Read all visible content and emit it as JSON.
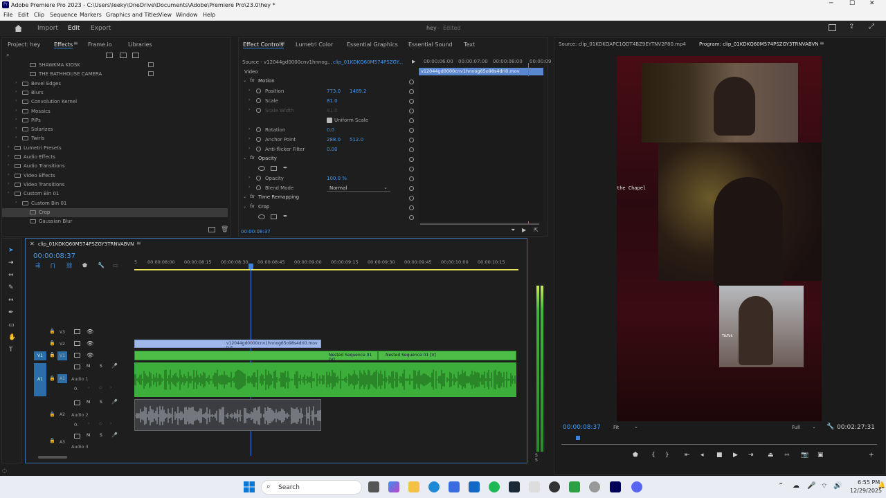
{
  "titlebar": {
    "title": "Adobe Premiere Pro 2023 - C:\\Users\\leeky\\OneDrive\\Documents\\Adobe\\Premiere Pro\\23.0\\hey *"
  },
  "menu": [
    "File",
    "Edit",
    "Clip",
    "Sequence",
    "Markers",
    "Graphics and Titles",
    "View",
    "Window",
    "Help"
  ],
  "workspace": {
    "tabs": [
      "Import",
      "Edit",
      "Export"
    ],
    "active": "Edit",
    "project": "hey",
    "status": "Edited"
  },
  "left_panel": {
    "tabs": [
      "Project: hey",
      "Effects",
      "Frame.io",
      "Libraries"
    ],
    "active": "Effects",
    "items": [
      {
        "label": "SHAWKMA KIOSK",
        "indent": 2
      },
      {
        "label": "THE BATHHOUSE CAMERA",
        "indent": 2
      },
      {
        "label": "Bevel Edges",
        "indent": 1
      },
      {
        "label": "Blurs",
        "indent": 1
      },
      {
        "label": "Convolution Kernel",
        "indent": 1
      },
      {
        "label": "Mosaics",
        "indent": 1
      },
      {
        "label": "PiPs",
        "indent": 1
      },
      {
        "label": "Solarizes",
        "indent": 1
      },
      {
        "label": "Twirls",
        "indent": 1
      },
      {
        "label": "Lumetri Presets",
        "indent": 0
      },
      {
        "label": "Audio Effects",
        "indent": 0
      },
      {
        "label": "Audio Transitions",
        "indent": 0
      },
      {
        "label": "Video Effects",
        "indent": 0
      },
      {
        "label": "Video Transitions",
        "indent": 0
      },
      {
        "label": "Custom Bin 01",
        "indent": 0
      },
      {
        "label": "Custom Bin 01",
        "indent": 1
      },
      {
        "label": "Crop",
        "indent": 2,
        "selected": true
      },
      {
        "label": "Gaussian Blur",
        "indent": 2
      }
    ]
  },
  "effect_controls": {
    "tabs": [
      "Effect Controls",
      "Lumetri Color",
      "Essential Graphics",
      "Essential Sound",
      "Text"
    ],
    "source": "Source - v12044gd0000cnv1hnnog...",
    "clip": "clip_01KDKQ60M574PSZGY...",
    "section": "Video",
    "timecodes": [
      "00:00:06:00",
      "00:00:07:00",
      "00:00:08:00",
      "00:00:09"
    ],
    "clip_bar": "v12044gd0000cnv1hnnog65o98s4dri0.mov",
    "current_time": "00:00:08:37",
    "rows": [
      {
        "label": "Motion",
        "type": "fx"
      },
      {
        "label": "Position",
        "v1": "773.0",
        "v2": "1489.2"
      },
      {
        "label": "Scale",
        "v1": "81.0"
      },
      {
        "label": "Scale Width",
        "v1": "81.0",
        "disabled": true
      },
      {
        "label": "Uniform Scale",
        "type": "check"
      },
      {
        "label": "Rotation",
        "v1": "0.0"
      },
      {
        "label": "Anchor Point",
        "v1": "288.0",
        "v2": "512.0"
      },
      {
        "label": "Anti-flicker Filter",
        "v1": "0.00"
      },
      {
        "label": "Opacity",
        "type": "fx"
      },
      {
        "label": "",
        "type": "masks"
      },
      {
        "label": "Opacity",
        "v1": "100.0 %"
      },
      {
        "label": "Blend Mode",
        "dropdown": "Normal"
      },
      {
        "label": "Time Remapping",
        "type": "fx"
      },
      {
        "label": "Crop",
        "type": "fx"
      },
      {
        "label": "",
        "type": "masks"
      }
    ]
  },
  "monitor": {
    "source_tab": "Source: clip_01KDKQAPC1QDT4BZ9EYTNV2P80.mp4",
    "program_tab": "Program: clip_01KDKQ60M574PSZGY3TRNVABVN",
    "overlay_text": "the Chapel",
    "tiktok": "TikTok",
    "current": "00:00:08:37",
    "fit": "Fit",
    "quality": "Full",
    "duration": "00:02:27:31"
  },
  "timeline": {
    "tab": "clip_01KDKQ60M574PSZGY3TRNVABVN",
    "current": "00:00:08:37",
    "ruler": [
      "5",
      "00:00:08:00",
      "00:00:08:15",
      "00:00:08:30",
      "00:00:08:45",
      "00:00:09:00",
      "00:00:09:15",
      "00:00:09:30",
      "00:00:09:45",
      "00:00:10:00",
      "00:00:10:15"
    ],
    "video_tracks": [
      "V3",
      "V2",
      "V1"
    ],
    "audio_tracks": [
      {
        "id": "A1",
        "name": "Audio 1",
        "vol": "0."
      },
      {
        "id": "A2",
        "name": "Audio 2",
        "vol": "0."
      },
      {
        "id": "A3",
        "name": "Audio 3"
      }
    ],
    "v2_clip": "v12044gd0000cnv1hnnog65o98s4dri0.mov [V]",
    "v1_clip1": "Nested Sequence 01 [V]",
    "v1_clip2": "Nested Sequence 01 [V]",
    "meter_label": "S S"
  },
  "taskbar": {
    "search": "Search",
    "time": "6:55 PM",
    "date": "12/29/2025"
  },
  "colors": {
    "accent": "#2d8ceb",
    "clip_green": "#4dbd47",
    "clip_blue": "#9fb7e8",
    "playhead": "#3b82d9"
  }
}
